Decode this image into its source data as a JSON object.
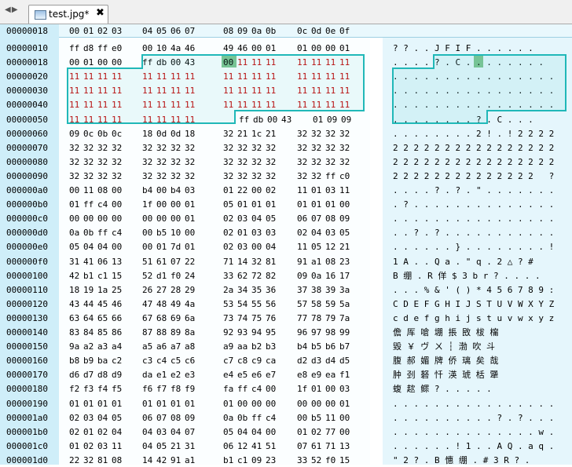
{
  "tab": {
    "title": "test.jpg*",
    "close": "✖",
    "nav": "◀ ▶"
  },
  "header": {
    "offset": "00000018",
    "columns": [
      "00",
      "01",
      "02",
      "03",
      "04",
      "05",
      "06",
      "07",
      "08",
      "09",
      "0a",
      "0b",
      "0c",
      "0d",
      "0e",
      "0f"
    ]
  },
  "selection": {
    "from_offset": "0000001d",
    "to_offset": "00000057",
    "byte_value": "11"
  },
  "rows": [
    {
      "offset": "00000010",
      "hex": [
        "ff",
        "d8",
        "ff",
        "e0",
        "00",
        "10",
        "4a",
        "46",
        "49",
        "46",
        "00",
        "01",
        "01",
        "00",
        "00",
        "01"
      ],
      "ascii": "? ? . . J F I F . . . . . ."
    },
    {
      "offset": "00000018",
      "hex": [
        "00",
        "01",
        "00",
        "00",
        "ff",
        "db",
        "00",
        "43",
        "00",
        "11",
        "11",
        "11",
        "11",
        "11",
        "11",
        "11"
      ],
      "ascii": ". . . . ? . C . . . . . . . ."
    },
    {
      "offset": "00000020",
      "hex": [
        "11",
        "11",
        "11",
        "11",
        "11",
        "11",
        "11",
        "11",
        "11",
        "11",
        "11",
        "11",
        "11",
        "11",
        "11",
        "11"
      ],
      "ascii": ". . . . . . . . . . . . . . . ."
    },
    {
      "offset": "00000030",
      "hex": [
        "11",
        "11",
        "11",
        "11",
        "11",
        "11",
        "11",
        "11",
        "11",
        "11",
        "11",
        "11",
        "11",
        "11",
        "11",
        "11"
      ],
      "ascii": ". . . . . . . . . . . . . . . ."
    },
    {
      "offset": "00000040",
      "hex": [
        "11",
        "11",
        "11",
        "11",
        "11",
        "11",
        "11",
        "11",
        "11",
        "11",
        "11",
        "11",
        "11",
        "11",
        "11",
        "11"
      ],
      "ascii": ". . . . . . . . . . . . . . . ."
    },
    {
      "offset": "00000050",
      "hex": [
        "11",
        "11",
        "11",
        "11",
        "11",
        "11",
        "11",
        "11",
        "ff",
        "db",
        "00",
        "43",
        "01",
        "09",
        "09"
      ],
      "ascii": ". . . . . . . . ? . C . . ."
    },
    {
      "offset": "00000060",
      "hex": [
        "09",
        "0c",
        "0b",
        "0c",
        "18",
        "0d",
        "0d",
        "18",
        "32",
        "21",
        "1c",
        "21",
        "32",
        "32",
        "32",
        "32"
      ],
      "ascii": ". . . . . . . . 2 ! . ! 2 2 2 2"
    },
    {
      "offset": "00000070",
      "hex": [
        "32",
        "32",
        "32",
        "32",
        "32",
        "32",
        "32",
        "32",
        "32",
        "32",
        "32",
        "32",
        "32",
        "32",
        "32",
        "32"
      ],
      "ascii": "2 2 2 2 2 2 2 2 2 2 2 2 2 2 2 2"
    },
    {
      "offset": "00000080",
      "hex": [
        "32",
        "32",
        "32",
        "32",
        "32",
        "32",
        "32",
        "32",
        "32",
        "32",
        "32",
        "32",
        "32",
        "32",
        "32",
        "32"
      ],
      "ascii": "2 2 2 2 2 2 2 2 2 2 2 2 2 2 2 2"
    },
    {
      "offset": "00000090",
      "hex": [
        "32",
        "32",
        "32",
        "32",
        "32",
        "32",
        "32",
        "32",
        "32",
        "32",
        "32",
        "32",
        "32",
        "32",
        "ff",
        "c0"
      ],
      "ascii": "2 2 2 2 2 2 2 2 2 2 2 2 2 2   ?"
    },
    {
      "offset": "000000a0",
      "hex": [
        "00",
        "11",
        "08",
        "00",
        "b4",
        "00",
        "b4",
        "03",
        "01",
        "22",
        "00",
        "02",
        "11",
        "01",
        "03",
        "11"
      ],
      "ascii": ". . . . ? . ? . \" . . . . . . ."
    },
    {
      "offset": "000000b0",
      "hex": [
        "01",
        "ff",
        "c4",
        "00",
        "1f",
        "00",
        "00",
        "01",
        "05",
        "01",
        "01",
        "01",
        "01",
        "01",
        "01",
        "00"
      ],
      "ascii": ". ? . . . . . . . . . . . . . ."
    },
    {
      "offset": "000000c0",
      "hex": [
        "00",
        "00",
        "00",
        "00",
        "00",
        "00",
        "00",
        "01",
        "02",
        "03",
        "04",
        "05",
        "06",
        "07",
        "08",
        "09"
      ],
      "ascii": ". . . . . . . . . . . . . . . ."
    },
    {
      "offset": "000000d0",
      "hex": [
        "0a",
        "0b",
        "ff",
        "c4",
        "00",
        "b5",
        "10",
        "00",
        "02",
        "01",
        "03",
        "03",
        "02",
        "04",
        "03",
        "05"
      ],
      "ascii": ". . ? . ? . . . . . . . . . . ."
    },
    {
      "offset": "000000e0",
      "hex": [
        "05",
        "04",
        "04",
        "00",
        "00",
        "01",
        "7d",
        "01",
        "02",
        "03",
        "00",
        "04",
        "11",
        "05",
        "12",
        "21"
      ],
      "ascii": ". . . . . . } . . . . . . . . !"
    },
    {
      "offset": "000000f0",
      "hex": [
        "31",
        "41",
        "06",
        "13",
        "51",
        "61",
        "07",
        "22",
        "71",
        "14",
        "32",
        "81",
        "91",
        "a1",
        "08",
        "23"
      ],
      "ascii": "1 A . . Q a . \" q . 2 △ ? # "
    },
    {
      "offset": "00000100",
      "hex": [
        "42",
        "b1",
        "c1",
        "15",
        "52",
        "d1",
        "f0",
        "24",
        "33",
        "62",
        "72",
        "82",
        "09",
        "0a",
        "16",
        "17"
      ],
      "ascii": "B 绷 . R 佯 $ 3 b r ? . . . ."
    },
    {
      "offset": "00000110",
      "hex": [
        "18",
        "19",
        "1a",
        "25",
        "26",
        "27",
        "28",
        "29",
        "2a",
        "34",
        "35",
        "36",
        "37",
        "38",
        "39",
        "3a"
      ],
      "ascii": ". . . % & ' ( ) * 4 5 6 7 8 9 :"
    },
    {
      "offset": "00000120",
      "hex": [
        "43",
        "44",
        "45",
        "46",
        "47",
        "48",
        "49",
        "4a",
        "53",
        "54",
        "55",
        "56",
        "57",
        "58",
        "59",
        "5a"
      ],
      "ascii": "C D E F G H I J S T U V W X Y Z"
    },
    {
      "offset": "00000130",
      "hex": [
        "63",
        "64",
        "65",
        "66",
        "67",
        "68",
        "69",
        "6a",
        "73",
        "74",
        "75",
        "76",
        "77",
        "78",
        "79",
        "7a"
      ],
      "ascii": "c d e f g h i j s t u v w x y z"
    },
    {
      "offset": "00000140",
      "hex": [
        "83",
        "84",
        "85",
        "86",
        "87",
        "88",
        "89",
        "8a",
        "92",
        "93",
        "94",
        "95",
        "96",
        "97",
        "98",
        "99"
      ],
      "ascii": "儋 厍 嗆 堋 掁 敃 柭 橣"
    },
    {
      "offset": "00000150",
      "hex": [
        "9a",
        "a2",
        "a3",
        "a4",
        "a5",
        "a6",
        "a7",
        "a8",
        "a9",
        "aa",
        "b2",
        "b3",
        "b4",
        "b5",
        "b6",
        "b7"
      ],
      "ascii": "毀 ￥ ヴ ㄨ ┆ 渤 吹 斗"
    },
    {
      "offset": "00000160",
      "hex": [
        "b8",
        "b9",
        "ba",
        "c2",
        "c3",
        "c4",
        "c5",
        "c6",
        "c7",
        "c8",
        "c9",
        "ca",
        "d2",
        "d3",
        "d4",
        "d5"
      ],
      "ascii": "腹 郝 媚 牌 侨 璃 矣 哉"
    },
    {
      "offset": "00000170",
      "hex": [
        "d6",
        "d7",
        "d8",
        "d9",
        "da",
        "e1",
        "e2",
        "e3",
        "e4",
        "e5",
        "e6",
        "e7",
        "e8",
        "e9",
        "ea",
        "f1"
      ],
      "ascii": "肿 刭 砮 忏 渶 琥 栝 犟"
    },
    {
      "offset": "00000180",
      "hex": [
        "f2",
        "f3",
        "f4",
        "f5",
        "f6",
        "f7",
        "f8",
        "f9",
        "fa",
        "ff",
        "c4",
        "00",
        "1f",
        "01",
        "00",
        "03"
      ],
      "ascii": "蝮 趑 鳏 ? . . . . ."
    },
    {
      "offset": "00000190",
      "hex": [
        "01",
        "01",
        "01",
        "01",
        "01",
        "01",
        "01",
        "01",
        "01",
        "00",
        "00",
        "00",
        "00",
        "00",
        "00",
        "01"
      ],
      "ascii": ". . . . . . . . . . . . . . . ."
    },
    {
      "offset": "000001a0",
      "hex": [
        "02",
        "03",
        "04",
        "05",
        "06",
        "07",
        "08",
        "09",
        "0a",
        "0b",
        "ff",
        "c4",
        "00",
        "b5",
        "11",
        "00"
      ],
      "ascii": ". . . . . . . . . . ? . ? . . ."
    },
    {
      "offset": "000001b0",
      "hex": [
        "02",
        "01",
        "02",
        "04",
        "04",
        "03",
        "04",
        "07",
        "05",
        "04",
        "04",
        "00",
        "01",
        "02",
        "77",
        "00"
      ],
      "ascii": ". . . . . . . . . . . . . . w ."
    },
    {
      "offset": "000001c0",
      "hex": [
        "01",
        "02",
        "03",
        "11",
        "04",
        "05",
        "21",
        "31",
        "06",
        "12",
        "41",
        "51",
        "07",
        "61",
        "71",
        "13"
      ],
      "ascii": ". . . . . . ! 1 . . A Q . a q ."
    },
    {
      "offset": "000001d0",
      "hex": [
        "22",
        "32",
        "81",
        "08",
        "14",
        "42",
        "91",
        "a1",
        "b1",
        "c1",
        "09",
        "23",
        "33",
        "52",
        "f0",
        "15"
      ],
      "ascii": "\" 2 ? . B 憓 绷 . # 3 R ? ."
    }
  ]
}
